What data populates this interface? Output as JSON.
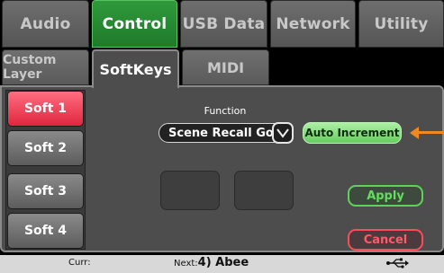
{
  "tabs": [
    {
      "label": "Audio",
      "active": false
    },
    {
      "label": "Control",
      "active": true
    },
    {
      "label": "USB Data",
      "active": false
    },
    {
      "label": "Network",
      "active": false
    },
    {
      "label": "Utility",
      "active": false
    }
  ],
  "subtabs": [
    {
      "label": "Custom Layer",
      "active": false
    },
    {
      "label": "SoftKeys",
      "active": true
    },
    {
      "label": "MIDI",
      "active": false
    }
  ],
  "softkeys": [
    {
      "label": "Soft 1",
      "selected": true
    },
    {
      "label": "Soft 2",
      "selected": false
    },
    {
      "label": "Soft 3",
      "selected": false
    },
    {
      "label": "Soft 4",
      "selected": false
    }
  ],
  "function": {
    "label": "Function",
    "value": "Scene Recall Go",
    "dropdown_icon": "chevron-down-icon"
  },
  "auto_increment_label": "Auto Increment",
  "apply_label": "Apply",
  "cancel_label": "Cancel",
  "status": {
    "curr_label": "Curr:",
    "next_label": "Next:",
    "next_value": "4) Abee",
    "usb_icon": "usb-icon"
  },
  "colors": {
    "accent_green": "#1f7a2a",
    "selected_red": "#e0263f",
    "pointer_orange": "#f08a1c"
  }
}
